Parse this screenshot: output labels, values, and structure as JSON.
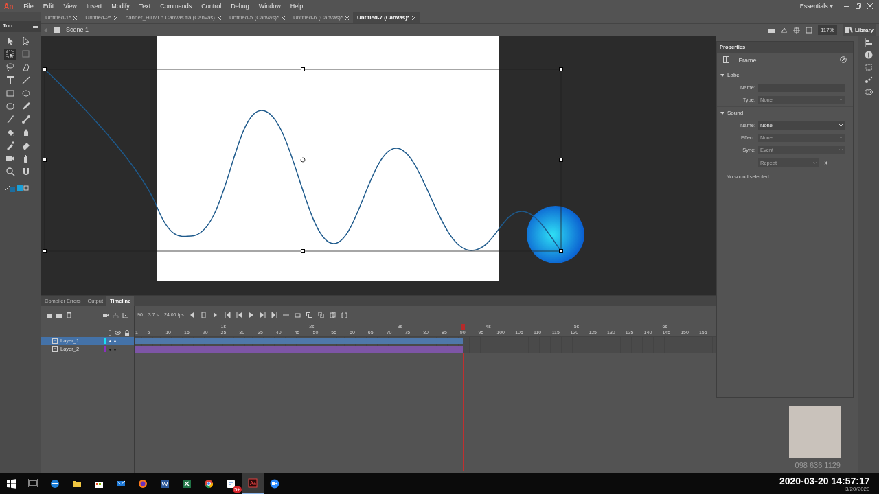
{
  "menu_bar": {
    "logo": "An",
    "menus": [
      "File",
      "Edit",
      "View",
      "Insert",
      "Modify",
      "Text",
      "Commands",
      "Control",
      "Debug",
      "Window",
      "Help"
    ],
    "workspace": "Essentials"
  },
  "toolbox": {
    "title": "Too...",
    "tools": [
      {
        "selected": false
      },
      {
        "selected": false
      },
      {
        "selected": true
      },
      {
        "selected": false
      },
      {
        "selected": false
      },
      {
        "selected": false
      },
      {
        "selected": false
      },
      {
        "selected": false
      },
      {
        "selected": false
      },
      {
        "selected": false
      },
      {
        "selected": false
      },
      {
        "selected": false
      },
      {
        "selected": false
      },
      {
        "selected": false
      },
      {
        "selected": false
      },
      {
        "selected": false
      },
      {
        "selected": false
      },
      {
        "selected": false
      },
      {
        "selected": false
      },
      {
        "selected": false
      },
      {
        "selected": false
      },
      {
        "selected": false
      }
    ]
  },
  "document_tabs": [
    {
      "label": "Untitled-1*",
      "selected": false
    },
    {
      "label": "Untitled-2*",
      "selected": false
    },
    {
      "label": "banner_HTML5 Canvas.fla (Canvas)",
      "selected": false
    },
    {
      "label": "Untitled-5 (Canvas)*",
      "selected": false
    },
    {
      "label": "Untitled-6 (Canvas)*",
      "selected": false
    },
    {
      "label": "Untitled-7 (Canvas)*",
      "selected": true
    }
  ],
  "edit_bar": {
    "scene": "Scene 1",
    "zoom": "117%",
    "library": "Library"
  },
  "properties": {
    "title": "Properties",
    "target": "Frame",
    "sections": [
      {
        "title": "Label",
        "expanded": true,
        "fields": [
          {
            "label": "Name:",
            "kind": "input",
            "disabled": false
          },
          {
            "label": "Type:",
            "kind": "select",
            "value": "None",
            "disabled": true
          }
        ]
      },
      {
        "title": "Sound",
        "expanded": true,
        "fields": [
          {
            "label": "Name:",
            "kind": "select",
            "value": "None",
            "disabled": false
          },
          {
            "label": "Effect:",
            "kind": "select",
            "value": "None",
            "disabled": true
          },
          {
            "label": "Sync:",
            "kind": "select",
            "value": "Event",
            "disabled": true
          },
          {
            "kind": "repeat",
            "value": "Repeat",
            "disabled": true,
            "suffix": "x"
          }
        ],
        "note": "No sound selected"
      }
    ]
  },
  "timeline": {
    "tabs": [
      {
        "label": "Compiler Errors",
        "selected": false
      },
      {
        "label": "Output",
        "selected": false
      },
      {
        "label": "Timeline",
        "selected": true
      }
    ],
    "frame": "90",
    "duration": "3.7 s",
    "fps": "24.00 fps",
    "seconds": [
      "1s",
      "2s",
      "3s",
      "4s",
      "5s",
      "6s"
    ],
    "frame_numbers": [
      "1",
      "5",
      "10",
      "15",
      "20",
      "25",
      "30",
      "35",
      "40",
      "45",
      "50",
      "55",
      "60",
      "65",
      "70",
      "75",
      "80",
      "85",
      "90",
      "95",
      "100",
      "105",
      "110",
      "115",
      "120",
      "125",
      "130",
      "135",
      "140",
      "145",
      "150",
      "155"
    ],
    "layers": [
      {
        "name": "Layer_1",
        "selected": true,
        "color": "#19e0f5"
      },
      {
        "name": "Layer_2",
        "selected": false,
        "color": "#8a2fbf"
      }
    ]
  },
  "webcam": {
    "caption": "098 636 1129"
  },
  "taskbar": {
    "apps": [
      {
        "selected": false
      },
      {
        "selected": false
      },
      {
        "selected": false
      },
      {
        "selected": false
      },
      {
        "selected": false
      },
      {
        "selected": false
      },
      {
        "selected": false
      },
      {
        "selected": false
      },
      {
        "selected": false
      },
      {
        "selected": false,
        "badge": "5+"
      },
      {
        "selected": true
      },
      {
        "selected": false
      }
    ],
    "timestamp": "2020-03-20 14:57:17",
    "clock_date": "3/20/2020"
  }
}
